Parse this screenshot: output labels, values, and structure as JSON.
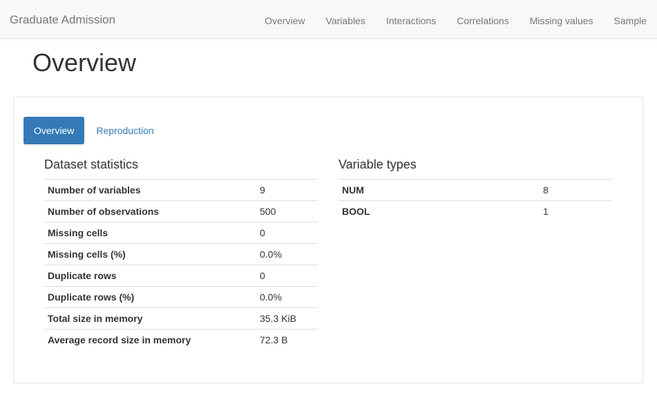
{
  "navbar": {
    "brand": "Graduate Admission",
    "links": [
      "Overview",
      "Variables",
      "Interactions",
      "Correlations",
      "Missing values",
      "Sample"
    ]
  },
  "page": {
    "title": "Overview"
  },
  "tabs": [
    "Overview",
    "Reproduction"
  ],
  "dataset_statistics": {
    "heading": "Dataset statistics",
    "rows": [
      {
        "label": "Number of variables",
        "value": "9"
      },
      {
        "label": "Number of observations",
        "value": "500"
      },
      {
        "label": "Missing cells",
        "value": "0"
      },
      {
        "label": "Missing cells (%)",
        "value": "0.0%"
      },
      {
        "label": "Duplicate rows",
        "value": "0"
      },
      {
        "label": "Duplicate rows (%)",
        "value": "0.0%"
      },
      {
        "label": "Total size in memory",
        "value": "35.3 KiB"
      },
      {
        "label": "Average record size in memory",
        "value": "72.3 B"
      }
    ]
  },
  "variable_types": {
    "heading": "Variable types",
    "rows": [
      {
        "label": "NUM",
        "value": "8"
      },
      {
        "label": "BOOL",
        "value": "1"
      }
    ]
  },
  "colors": {
    "accent": "#337ab7",
    "navbar_bg": "#f8f8f8",
    "muted_text": "#777777"
  }
}
